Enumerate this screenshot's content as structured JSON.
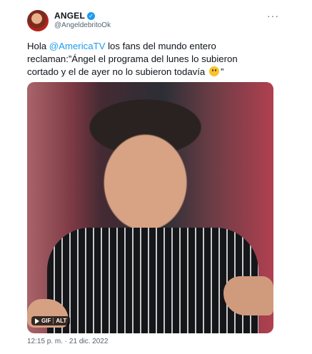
{
  "tweet": {
    "display_name": "ANGEL",
    "handle": "@AngeldebritoOk",
    "more_icon": "···",
    "verified_icon": "✓",
    "text_prefix": "Hola ",
    "mention": "@AmericaTV",
    "text_body": " los fans del mundo entero reclaman:”Ángel el programa del lunes lo subieron cortado y el de ayer no lo subieron todavía",
    "text_suffix": "”",
    "emoji": "pensive-face-emoji",
    "media": {
      "badge_gif": "GIF",
      "badge_alt": "ALT"
    },
    "timestamp": "12:15 p. m. · 21 dic. 2022"
  },
  "colors": {
    "mention": "#1d9bf0",
    "verified": "#1d9bf0",
    "secondary_text": "#536471"
  }
}
